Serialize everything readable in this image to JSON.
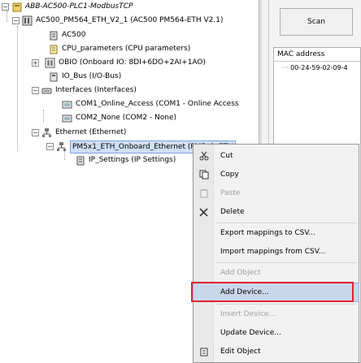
{
  "tree": {
    "root": "ABB-AC500-PLC1-ModbusTCP",
    "plc": "AC500_PM564_ETH_V2_1 (AC500 PM564-ETH V2.1)",
    "ac500": "AC500",
    "cpu_params": "CPU_parameters (CPU parameters)",
    "obio": "OBIO (Onboard IO: 8DI+6DO+2AI+1AO)",
    "io_bus": "IO_Bus (I/O-Bus)",
    "interfaces": "Interfaces (Interfaces)",
    "com1": "COM1_Online_Access (COM1 - Online Access",
    "com2": "COM2_None (COM2 - None)",
    "ethernet": "Ethernet (Ethernet)",
    "pm5x1": "PM5x1_ETH_Onboard_Ethernet (PM5x1_ETH",
    "ip_settings": "IP_Settings (IP Settings)"
  },
  "right": {
    "scan_label": "Scan",
    "mac_header": "MAC address",
    "mac_value": "00-24-59-02-09-4"
  },
  "menu": {
    "cut": "Cut",
    "copy": "Copy",
    "paste": "Paste",
    "delete": "Delete",
    "export": "Export mappings to CSV...",
    "import": "Import mappings from CSV...",
    "add_object": "Add Object",
    "add_device": "Add Device...",
    "insert_device": "Insert Device...",
    "update_device": "Update Device...",
    "edit_object": "Edit Object"
  },
  "colors": {
    "highlight": "#cad6ea",
    "callout": "#e0242c",
    "selection": "#cfe0f6"
  }
}
